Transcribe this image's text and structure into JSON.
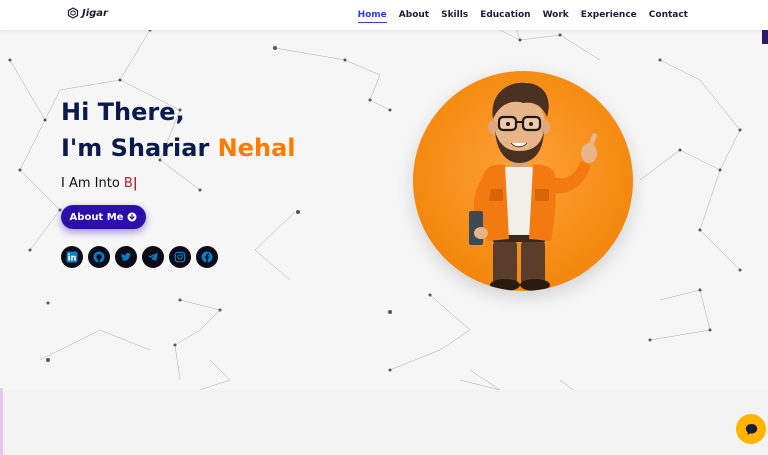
{
  "navbar": {
    "brand": "Jigar",
    "brand_icon": "hexagon-logo-icon",
    "links": [
      {
        "label": "Home",
        "active": true
      },
      {
        "label": "About"
      },
      {
        "label": "Skills"
      },
      {
        "label": "Education"
      },
      {
        "label": "Work"
      },
      {
        "label": "Experience"
      },
      {
        "label": "Contact"
      }
    ]
  },
  "hero": {
    "line1": "Hi There,",
    "line2_prefix": "I'm Shariar ",
    "line2_accent": "Nehal",
    "typed_prefix": "I Am Into ",
    "typed_word": "B",
    "typed_cursor": "|",
    "button_label": "About Me",
    "button_icon": "arrow-circle-down-icon",
    "socials": [
      "linkedin-icon",
      "github-icon",
      "twitter-icon",
      "telegram-icon",
      "instagram-icon",
      "facebook-icon"
    ],
    "avatar": "cartoon-developer-avatar"
  },
  "chat": {
    "icon": "chat-bubble-icon"
  },
  "colors": {
    "primary": "#2a0fa8",
    "accent": "#ff7a00",
    "heading": "#0a1a4a",
    "typed": "#c0182a",
    "chat": "#ffb400"
  }
}
